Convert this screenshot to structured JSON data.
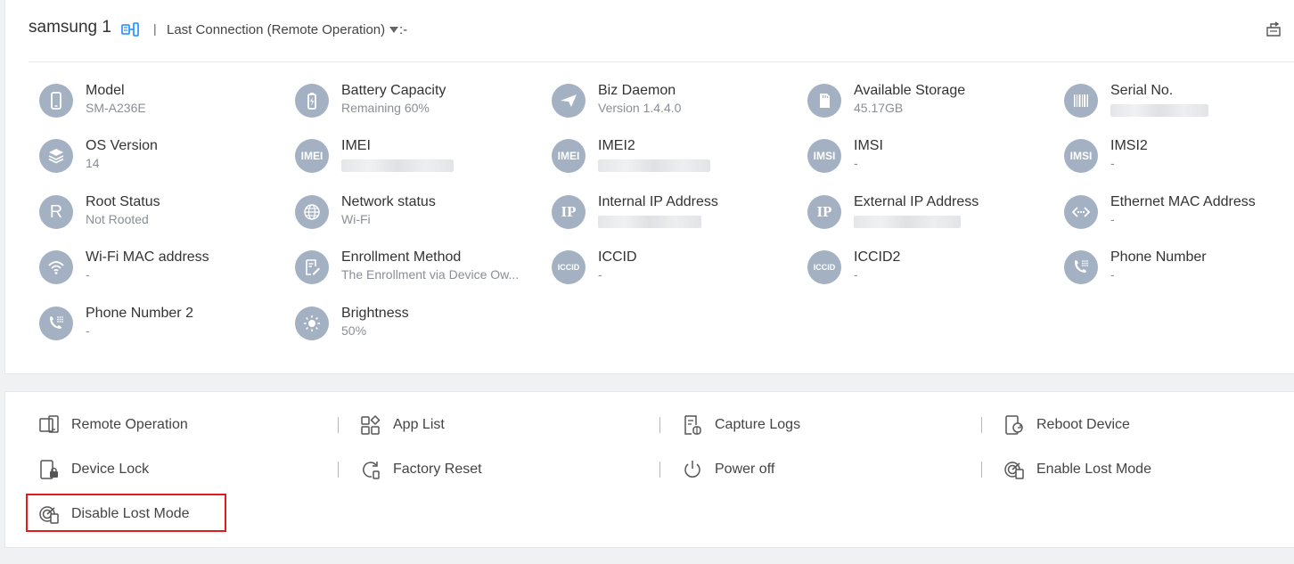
{
  "header": {
    "device_name": "samsung 1",
    "separator": "|",
    "connection_label": "Last Connection (Remote Operation)",
    "connection_value": ":-"
  },
  "info": [
    {
      "label": "Model",
      "value": "SM-A236E",
      "icon": "phone-icon"
    },
    {
      "label": "Battery Capacity",
      "value": "Remaining 60%",
      "icon": "battery-icon"
    },
    {
      "label": "Biz Daemon",
      "value": "Version 1.4.4.0",
      "icon": "paper-plane-icon"
    },
    {
      "label": "Available Storage",
      "value": "45.17GB",
      "icon": "sd-card-icon"
    },
    {
      "label": "Serial No.",
      "value": "",
      "icon": "barcode-icon"
    },
    {
      "label": "OS Version",
      "value": "14",
      "icon": "layers-icon"
    },
    {
      "label": "IMEI",
      "value": "",
      "icon": "imei-icon",
      "icon_text": "IMEI"
    },
    {
      "label": "IMEI2",
      "value": "",
      "icon": "imei2-icon",
      "icon_text": "IMEI"
    },
    {
      "label": "IMSI",
      "value": "-",
      "icon": "imsi-icon",
      "icon_text": "IMSI"
    },
    {
      "label": "IMSI2",
      "value": "-",
      "icon": "imsi2-icon",
      "icon_text": "IMSI"
    },
    {
      "label": "Root Status",
      "value": "Not Rooted",
      "icon": "root-icon",
      "icon_text": "R"
    },
    {
      "label": "Network status",
      "value": "Wi-Fi",
      "icon": "globe-icon"
    },
    {
      "label": "Internal IP Address",
      "value": "",
      "icon": "ip-icon",
      "icon_text": "IP"
    },
    {
      "label": "External IP Address",
      "value": "",
      "icon": "ip-external-icon",
      "icon_text": "IP"
    },
    {
      "label": "Ethernet MAC Address",
      "value": "-",
      "icon": "ethernet-icon"
    },
    {
      "label": "Wi-Fi MAC address",
      "value": "-",
      "icon": "wifi-icon"
    },
    {
      "label": "Enrollment Method",
      "value": "The Enrollment via Device Ow...",
      "icon": "form-icon"
    },
    {
      "label": "ICCID",
      "value": "-",
      "icon": "sim-icon",
      "icon_text": "ICCID"
    },
    {
      "label": "ICCID2",
      "value": "-",
      "icon": "sim2-icon",
      "icon_text": "ICCID"
    },
    {
      "label": "Phone Number",
      "value": "-",
      "icon": "phone-dial-icon"
    },
    {
      "label": "Phone Number 2",
      "value": "-",
      "icon": "phone-dial2-icon"
    },
    {
      "label": "Brightness",
      "value": "50%",
      "icon": "sun-icon"
    }
  ],
  "actions": [
    {
      "label": "Remote Operation",
      "icon": "remote-operation-icon"
    },
    {
      "label": "App List",
      "icon": "app-list-icon"
    },
    {
      "label": "Capture Logs",
      "icon": "capture-logs-icon"
    },
    {
      "label": "Reboot Device",
      "icon": "reboot-icon"
    },
    {
      "label": "Device Lock",
      "icon": "device-lock-icon"
    },
    {
      "label": "Factory Reset",
      "icon": "factory-reset-icon"
    },
    {
      "label": "Power off",
      "icon": "power-icon"
    },
    {
      "label": "Enable Lost Mode",
      "icon": "lost-mode-icon"
    },
    {
      "label": "Disable Lost Mode",
      "icon": "disable-lost-mode-icon"
    }
  ],
  "colors": {
    "icon_bg": "#a3b1c2",
    "accent": "#1a8cff",
    "highlight": "#e01b1b"
  }
}
